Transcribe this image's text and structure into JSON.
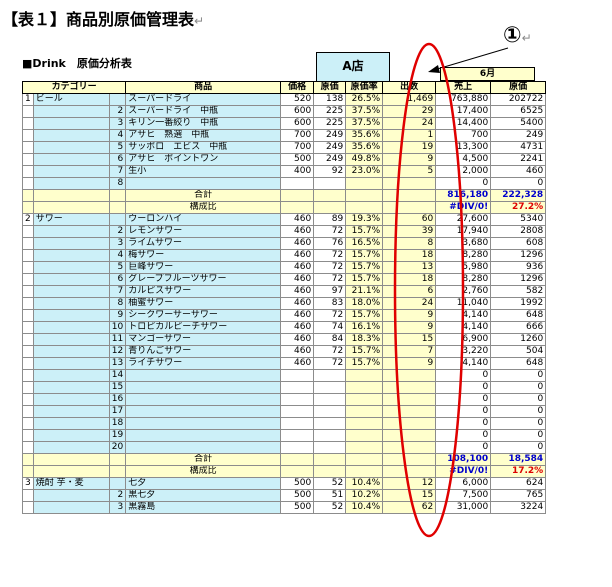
{
  "page": {
    "title": "【表１】商品別原価管理表",
    "title_mark": "↵",
    "sheet_title": "■Drink　原価分析表",
    "store_label": "A店",
    "month_label": "6月",
    "callout_number": "①",
    "callout_mark": "↵"
  },
  "table": {
    "headers": [
      "カテゴリー",
      "商品",
      "価格",
      "原価",
      "原価率",
      "出数",
      "売上",
      "原価"
    ],
    "total_label": "合計",
    "ratio_label": "構成比",
    "rows": [
      {
        "kind": "item",
        "catno": "1",
        "cat": "ビール",
        "idx": "",
        "name": "スーパードライ",
        "price": "520",
        "cost": "138",
        "rate": "26.5%",
        "qty": "1,469",
        "sales": "763,880",
        "costsum": "202722"
      },
      {
        "kind": "item",
        "catno": "",
        "cat": "",
        "idx": "2",
        "name": "スーパードライ　中瓶",
        "price": "600",
        "cost": "225",
        "rate": "37.5%",
        "qty": "29",
        "sales": "17,400",
        "costsum": "6525"
      },
      {
        "kind": "item",
        "catno": "",
        "cat": "",
        "idx": "3",
        "name": "キリン一番絞り　中瓶",
        "price": "600",
        "cost": "225",
        "rate": "37.5%",
        "qty": "24",
        "sales": "14,400",
        "costsum": "5400"
      },
      {
        "kind": "item",
        "catno": "",
        "cat": "",
        "idx": "4",
        "name": "アサヒ　熟選　中瓶",
        "price": "700",
        "cost": "249",
        "rate": "35.6%",
        "qty": "1",
        "sales": "700",
        "costsum": "249"
      },
      {
        "kind": "item",
        "catno": "",
        "cat": "",
        "idx": "5",
        "name": "サッポロ　エビス　中瓶",
        "price": "700",
        "cost": "249",
        "rate": "35.6%",
        "qty": "19",
        "sales": "13,300",
        "costsum": "4731"
      },
      {
        "kind": "item",
        "catno": "",
        "cat": "",
        "idx": "6",
        "name": "アサヒ　ポイントワン",
        "price": "500",
        "cost": "249",
        "rate": "49.8%",
        "qty": "9",
        "sales": "4,500",
        "costsum": "2241"
      },
      {
        "kind": "item",
        "catno": "",
        "cat": "",
        "idx": "7",
        "name": "生小",
        "price": "400",
        "cost": "92",
        "rate": "23.0%",
        "qty": "5",
        "sales": "2,000",
        "costsum": "460"
      },
      {
        "kind": "item",
        "catno": "",
        "cat": "",
        "idx": "8",
        "name": "",
        "price": "",
        "cost": "",
        "rate": "",
        "qty": "",
        "sales": "0",
        "costsum": "0"
      },
      {
        "kind": "total",
        "sales": "816,180",
        "costsum": "222,328"
      },
      {
        "kind": "ratio",
        "sales": "#DIV/0!",
        "costsum": "27.2%"
      },
      {
        "kind": "item",
        "catno": "2",
        "cat": "サワー",
        "idx": "",
        "name": "ウーロンハイ",
        "price": "460",
        "cost": "89",
        "rate": "19.3%",
        "qty": "60",
        "sales": "27,600",
        "costsum": "5340"
      },
      {
        "kind": "item",
        "catno": "",
        "cat": "",
        "idx": "2",
        "name": "レモンサワー",
        "price": "460",
        "cost": "72",
        "rate": "15.7%",
        "qty": "39",
        "sales": "17,940",
        "costsum": "2808"
      },
      {
        "kind": "item",
        "catno": "",
        "cat": "",
        "idx": "3",
        "name": "ライムサワー",
        "price": "460",
        "cost": "76",
        "rate": "16.5%",
        "qty": "8",
        "sales": "3,680",
        "costsum": "608"
      },
      {
        "kind": "item",
        "catno": "",
        "cat": "",
        "idx": "4",
        "name": "梅サワー",
        "price": "460",
        "cost": "72",
        "rate": "15.7%",
        "qty": "18",
        "sales": "8,280",
        "costsum": "1296"
      },
      {
        "kind": "item",
        "catno": "",
        "cat": "",
        "idx": "5",
        "name": "巨峰サワー",
        "price": "460",
        "cost": "72",
        "rate": "15.7%",
        "qty": "13",
        "sales": "5,980",
        "costsum": "936"
      },
      {
        "kind": "item",
        "catno": "",
        "cat": "",
        "idx": "6",
        "name": "グレープフルーツサワー",
        "price": "460",
        "cost": "72",
        "rate": "15.7%",
        "qty": "18",
        "sales": "8,280",
        "costsum": "1296"
      },
      {
        "kind": "item",
        "catno": "",
        "cat": "",
        "idx": "7",
        "name": "カルピスサワー",
        "price": "460",
        "cost": "97",
        "rate": "21.1%",
        "qty": "6",
        "sales": "2,760",
        "costsum": "582"
      },
      {
        "kind": "item",
        "catno": "",
        "cat": "",
        "idx": "8",
        "name": "柚蜜サワー",
        "price": "460",
        "cost": "83",
        "rate": "18.0%",
        "qty": "24",
        "sales": "11,040",
        "costsum": "1992"
      },
      {
        "kind": "item",
        "catno": "",
        "cat": "",
        "idx": "9",
        "name": "シークワーサーサワー",
        "price": "460",
        "cost": "72",
        "rate": "15.7%",
        "qty": "9",
        "sales": "4,140",
        "costsum": "648"
      },
      {
        "kind": "item",
        "catno": "",
        "cat": "",
        "idx": "10",
        "name": "トロピカルピーチサワー",
        "price": "460",
        "cost": "74",
        "rate": "16.1%",
        "qty": "9",
        "sales": "4,140",
        "costsum": "666"
      },
      {
        "kind": "item",
        "catno": "",
        "cat": "",
        "idx": "11",
        "name": "マンゴーサワー",
        "price": "460",
        "cost": "84",
        "rate": "18.3%",
        "qty": "15",
        "sales": "6,900",
        "costsum": "1260"
      },
      {
        "kind": "item",
        "catno": "",
        "cat": "",
        "idx": "12",
        "name": "青りんごサワー",
        "price": "460",
        "cost": "72",
        "rate": "15.7%",
        "qty": "7",
        "sales": "3,220",
        "costsum": "504"
      },
      {
        "kind": "item",
        "catno": "",
        "cat": "",
        "idx": "13",
        "name": "ライチサワー",
        "price": "460",
        "cost": "72",
        "rate": "15.7%",
        "qty": "9",
        "sales": "4,140",
        "costsum": "648"
      },
      {
        "kind": "item",
        "catno": "",
        "cat": "",
        "idx": "14",
        "name": "",
        "price": "",
        "cost": "",
        "rate": "",
        "qty": "",
        "sales": "0",
        "costsum": "0"
      },
      {
        "kind": "item",
        "catno": "",
        "cat": "",
        "idx": "15",
        "name": "",
        "price": "",
        "cost": "",
        "rate": "",
        "qty": "",
        "sales": "0",
        "costsum": "0"
      },
      {
        "kind": "item",
        "catno": "",
        "cat": "",
        "idx": "16",
        "name": "",
        "price": "",
        "cost": "",
        "rate": "",
        "qty": "",
        "sales": "0",
        "costsum": "0"
      },
      {
        "kind": "item",
        "catno": "",
        "cat": "",
        "idx": "17",
        "name": "",
        "price": "",
        "cost": "",
        "rate": "",
        "qty": "",
        "sales": "0",
        "costsum": "0"
      },
      {
        "kind": "item",
        "catno": "",
        "cat": "",
        "idx": "18",
        "name": "",
        "price": "",
        "cost": "",
        "rate": "",
        "qty": "",
        "sales": "0",
        "costsum": "0"
      },
      {
        "kind": "item",
        "catno": "",
        "cat": "",
        "idx": "19",
        "name": "",
        "price": "",
        "cost": "",
        "rate": "",
        "qty": "",
        "sales": "0",
        "costsum": "0"
      },
      {
        "kind": "item",
        "catno": "",
        "cat": "",
        "idx": "20",
        "name": "",
        "price": "",
        "cost": "",
        "rate": "",
        "qty": "",
        "sales": "0",
        "costsum": "0"
      },
      {
        "kind": "total",
        "sales": "108,100",
        "costsum": "18,584"
      },
      {
        "kind": "ratio",
        "sales": "#DIV/0!",
        "costsum": "17.2%"
      },
      {
        "kind": "item",
        "catno": "3",
        "cat": "焼酎 芋・麦",
        "idx": "",
        "name": "七夕",
        "price": "500",
        "cost": "52",
        "rate": "10.4%",
        "qty": "12",
        "sales": "6,000",
        "costsum": "624"
      },
      {
        "kind": "item",
        "catno": "",
        "cat": "",
        "idx": "2",
        "name": "黒七夕",
        "price": "500",
        "cost": "51",
        "rate": "10.2%",
        "qty": "15",
        "sales": "7,500",
        "costsum": "765"
      },
      {
        "kind": "item",
        "catno": "",
        "cat": "",
        "idx": "3",
        "name": "黒霧島",
        "price": "500",
        "cost": "52",
        "rate": "10.4%",
        "qty": "62",
        "sales": "31,000",
        "costsum": "3224"
      }
    ]
  },
  "colors": {
    "cell_blue": "#ccf0f8",
    "cell_yellow": "#ffffcc",
    "annotation_red": "#e00000"
  }
}
